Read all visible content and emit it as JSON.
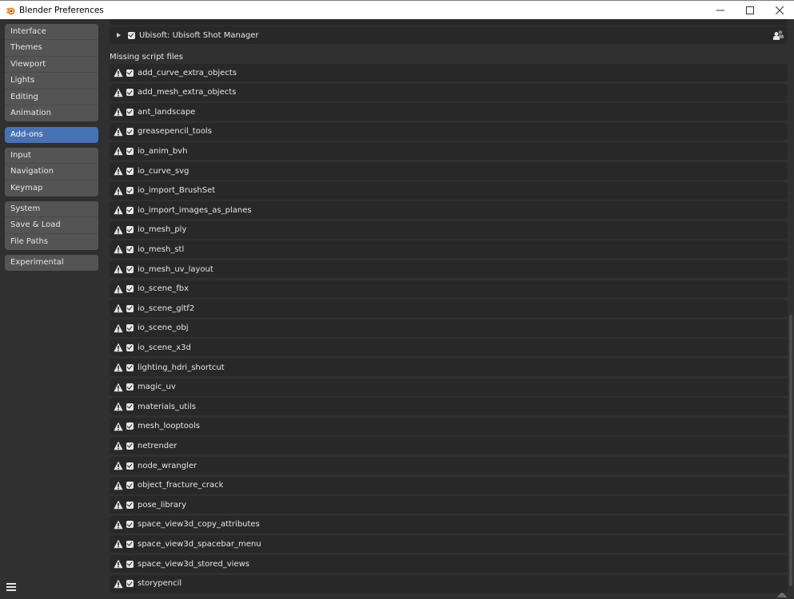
{
  "window": {
    "title": "Blender Preferences",
    "controls": {
      "minimize": "minimize",
      "maximize": "maximize",
      "close": "close"
    }
  },
  "sidebar": {
    "groups": [
      {
        "items": [
          {
            "label": "Interface",
            "active": false
          },
          {
            "label": "Themes",
            "active": false
          },
          {
            "label": "Viewport",
            "active": false
          },
          {
            "label": "Lights",
            "active": false
          },
          {
            "label": "Editing",
            "active": false
          },
          {
            "label": "Animation",
            "active": false
          }
        ]
      },
      {
        "items": [
          {
            "label": "Add-ons",
            "active": true
          }
        ]
      },
      {
        "items": [
          {
            "label": "Input",
            "active": false
          },
          {
            "label": "Navigation",
            "active": false
          },
          {
            "label": "Keymap",
            "active": false
          }
        ]
      },
      {
        "items": [
          {
            "label": "System",
            "active": false
          },
          {
            "label": "Save & Load",
            "active": false
          },
          {
            "label": "File Paths",
            "active": false
          }
        ]
      },
      {
        "items": [
          {
            "label": "Experimental",
            "active": false
          }
        ]
      }
    ],
    "menu_icon": "hamburger-menu-icon"
  },
  "main": {
    "top_addon": {
      "label": "Ubisoft: Ubisoft Shot Manager",
      "enabled": true,
      "expanded": false,
      "icon": "user-group-icon"
    },
    "missing_section_label": "Missing script files",
    "missing_addons": [
      {
        "label": "add_curve_extra_objects",
        "enabled": true
      },
      {
        "label": "add_mesh_extra_objects",
        "enabled": true
      },
      {
        "label": "ant_landscape",
        "enabled": true
      },
      {
        "label": "greasepencil_tools",
        "enabled": true
      },
      {
        "label": "io_anim_bvh",
        "enabled": true
      },
      {
        "label": "io_curve_svg",
        "enabled": true
      },
      {
        "label": "io_import_BrushSet",
        "enabled": true
      },
      {
        "label": "io_import_images_as_planes",
        "enabled": true
      },
      {
        "label": "io_mesh_ply",
        "enabled": true
      },
      {
        "label": "io_mesh_stl",
        "enabled": true
      },
      {
        "label": "io_mesh_uv_layout",
        "enabled": true
      },
      {
        "label": "io_scene_fbx",
        "enabled": true
      },
      {
        "label": "io_scene_gltf2",
        "enabled": true
      },
      {
        "label": "io_scene_obj",
        "enabled": true
      },
      {
        "label": "io_scene_x3d",
        "enabled": true
      },
      {
        "label": "lighting_hdri_shortcut",
        "enabled": true
      },
      {
        "label": "magic_uv",
        "enabled": true
      },
      {
        "label": "materials_utils",
        "enabled": true
      },
      {
        "label": "mesh_looptools",
        "enabled": true
      },
      {
        "label": "netrender",
        "enabled": true
      },
      {
        "label": "node_wrangler",
        "enabled": true
      },
      {
        "label": "object_fracture_crack",
        "enabled": true
      },
      {
        "label": "pose_library",
        "enabled": true
      },
      {
        "label": "space_view3d_copy_attributes",
        "enabled": true
      },
      {
        "label": "space_view3d_spacebar_menu",
        "enabled": true
      },
      {
        "label": "space_view3d_stored_views",
        "enabled": true
      },
      {
        "label": "storypencil",
        "enabled": true
      }
    ]
  },
  "colors": {
    "accent": "#4772b3",
    "background": "#303030",
    "row_background": "#282828",
    "nav_background": "#545454",
    "text": "#e6e6e6"
  }
}
